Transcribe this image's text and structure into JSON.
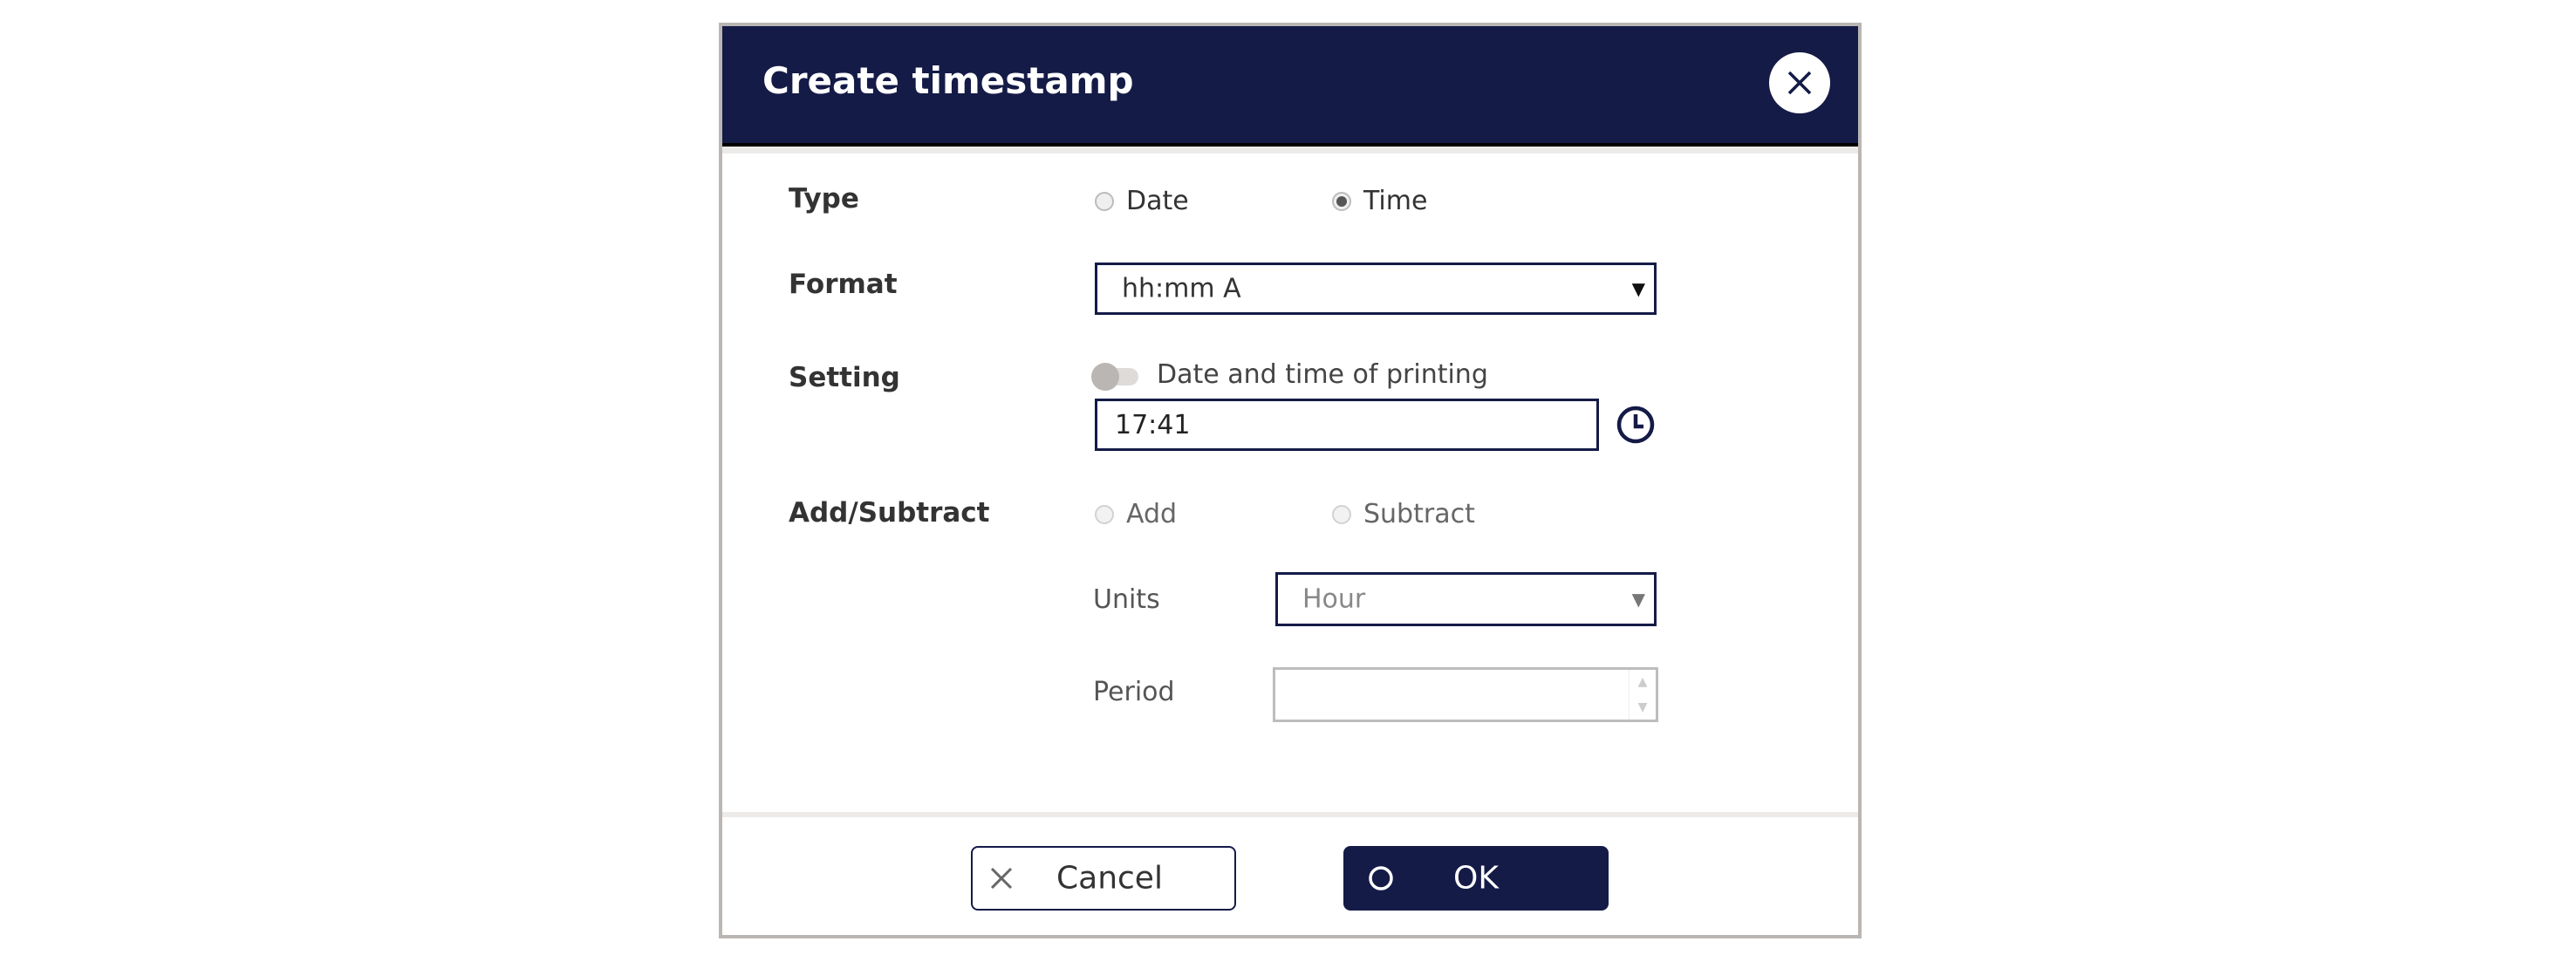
{
  "dialog": {
    "title": "Create timestamp",
    "close_icon": "close-icon"
  },
  "type": {
    "label": "Type",
    "options": [
      {
        "label": "Date",
        "checked": false
      },
      {
        "label": "Time",
        "checked": true
      }
    ]
  },
  "format": {
    "label": "Format",
    "value": "hh:mm A"
  },
  "setting": {
    "label": "Setting",
    "toggle_label": "Date and time of printing",
    "toggle_on": false,
    "time_value": "17:41",
    "clock_icon": "clock-icon"
  },
  "add_subtract": {
    "label": "Add/Subtract",
    "options": [
      {
        "label": "Add",
        "checked": false
      },
      {
        "label": "Subtract",
        "checked": false
      }
    ],
    "units_label": "Units",
    "units_value": "Hour",
    "period_label": "Period",
    "period_value": ""
  },
  "footer": {
    "cancel_label": "Cancel",
    "ok_label": "OK"
  },
  "colors": {
    "brand": "#151b47",
    "border": "#b9b6b3"
  }
}
